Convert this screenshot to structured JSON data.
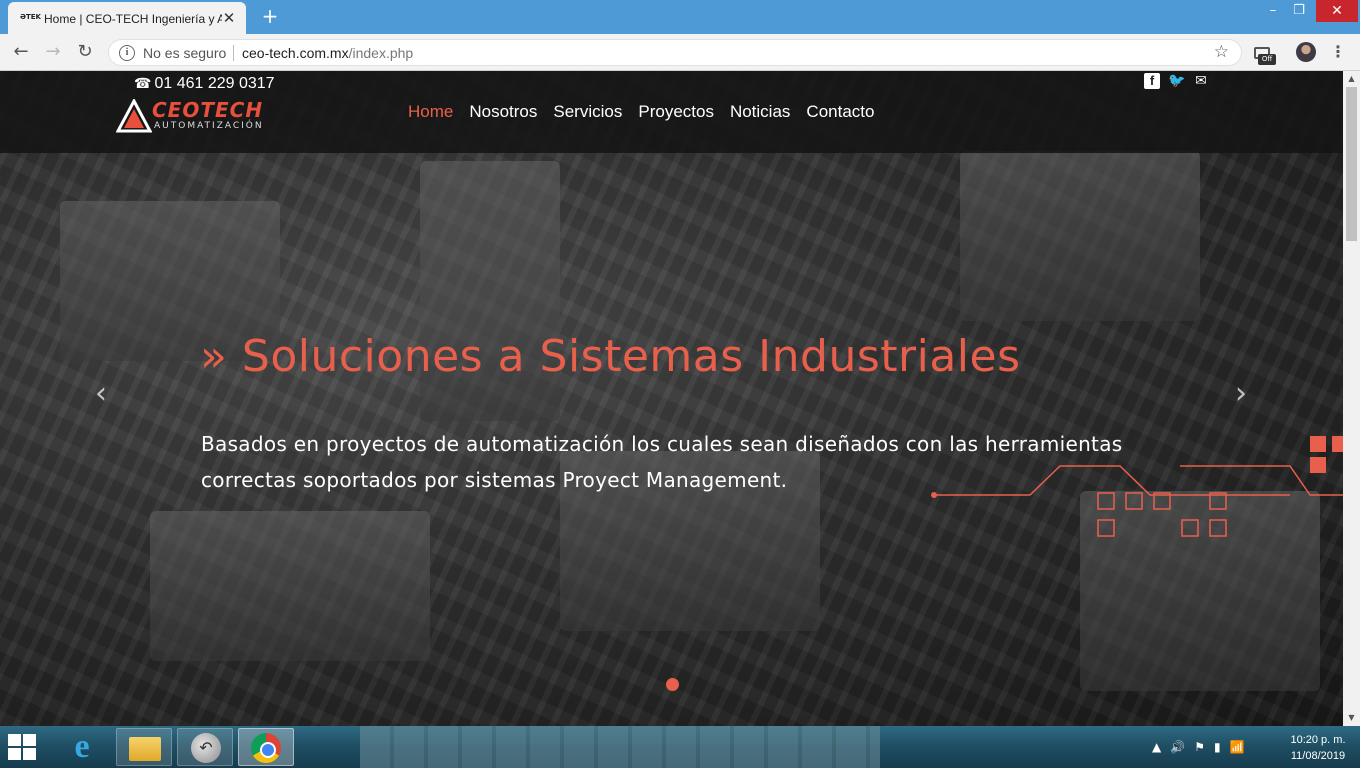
{
  "browser": {
    "tab_title": "Home | CEO-TECH Ingeniería y A",
    "tab_favicon_text": "ƏTEK",
    "tab_close": "✕",
    "new_tab": "+",
    "window_controls": {
      "minimize": "–",
      "maximize": "❐",
      "close": "✕"
    },
    "nav": {
      "back": "←",
      "forward": "→",
      "reload": "↻"
    },
    "security_label": "No es seguro",
    "url_host": "ceo-tech.com.mx",
    "url_path": "/index.php",
    "bookmark_icon": "☆",
    "extension_badge": "Off",
    "menu": "⋮"
  },
  "site": {
    "phone": "01 461 229 0317",
    "phone_icon": "☎",
    "logo": {
      "brand": "CEOTECH",
      "subtitle": "AUTOMATIZACIÓN"
    },
    "nav": [
      {
        "label": "Home",
        "active": true
      },
      {
        "label": "Nosotros",
        "active": false
      },
      {
        "label": "Servicios",
        "active": false
      },
      {
        "label": "Proyectos",
        "active": false
      },
      {
        "label": "Noticias",
        "active": false
      },
      {
        "label": "Contacto",
        "active": false
      }
    ],
    "social": {
      "facebook": "f",
      "twitter": "🐦",
      "email": "✉"
    },
    "hero": {
      "title": "» Soluciones a Sistemas Industriales",
      "text": "Basados en proyectos de automatización los cuales sean diseñados con las herramientas correctas soportados por sistemas Proyect Management.",
      "prev": "‹",
      "next": "›"
    },
    "colors": {
      "accent": "#e8604c",
      "header_bg": "#141414"
    }
  },
  "taskbar": {
    "clock_time": "10:20 p. m.",
    "clock_date": "11/08/2019",
    "tray_icons": [
      "▲",
      "🔊",
      "⚑",
      "▮",
      "📶"
    ]
  }
}
